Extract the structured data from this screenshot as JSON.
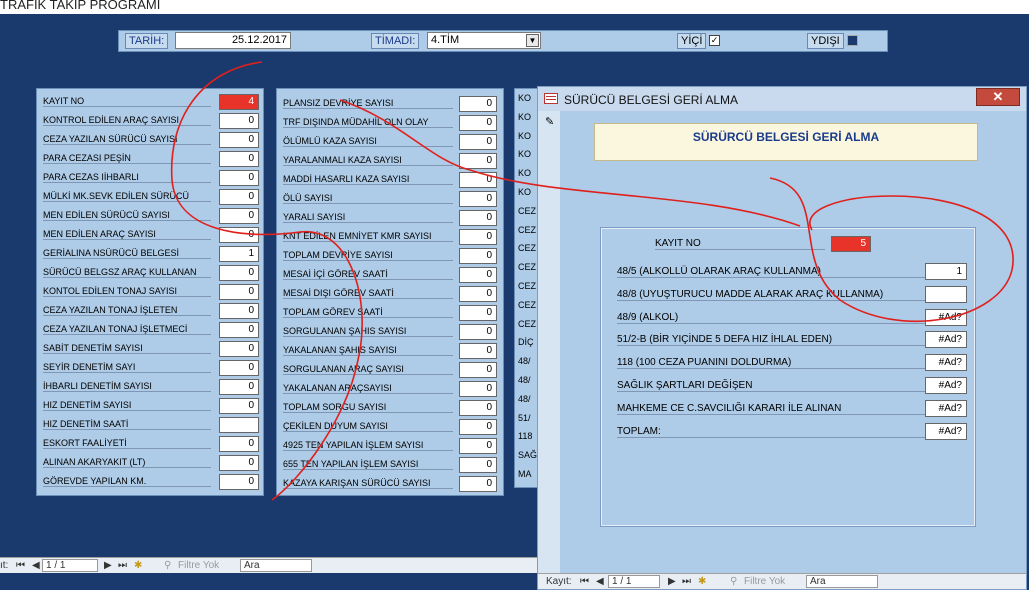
{
  "app": {
    "title": "TRAFİK TAKİP PROGRAMI"
  },
  "toolbar": {
    "date_label": "TARİH:",
    "date_value": "25.12.2017",
    "team_label": "TİMADI:",
    "team_value": "4.TİM",
    "inside_label": "YİÇİ",
    "inside_checked": "✓",
    "outside_label": "YDIŞI"
  },
  "left_panel": {
    "rows": [
      {
        "label": "KAYIT NO",
        "value": "4"
      },
      {
        "label": "KONTROL EDİLEN ARAÇ SAYISI",
        "value": "0"
      },
      {
        "label": "CEZA YAZILAN SÜRÜCÜ SAYISI",
        "value": "0"
      },
      {
        "label": "PARA CEZASI PEŞİN",
        "value": "0"
      },
      {
        "label": "PARA CEZAS IİHBARLI",
        "value": "0"
      },
      {
        "label": "MÜLKİ MK.SEVK EDİLEN SÜRÜCÜ",
        "value": "0"
      },
      {
        "label": "MEN EDİLEN SÜRÜCÜ SAYISI",
        "value": "0"
      },
      {
        "label": "MEN EDİLEN ARAÇ SAYISI",
        "value": "0"
      },
      {
        "label": "GERİALINA NSÜRÜCÜ BELGESİ",
        "value": "1"
      },
      {
        "label": "SÜRÜCÜ BELGSZ ARAÇ KULLANAN",
        "value": "0"
      },
      {
        "label": "KONTOL EDİLEN TONAJ SAYISI",
        "value": "0"
      },
      {
        "label": "CEZA YAZILAN TONAJ İŞLETEN",
        "value": "0"
      },
      {
        "label": "CEZA YAZILAN TONAJ İŞLETMECİ",
        "value": "0"
      },
      {
        "label": "SABİT DENETİM SAYISI",
        "value": "0"
      },
      {
        "label": "SEYİR DENETİM SAYI",
        "value": "0"
      },
      {
        "label": "İHBARLI DENETİM SAYISI",
        "value": "0"
      },
      {
        "label": "HIZ DENETİM SAYISI",
        "value": "0"
      },
      {
        "label": "HIZ DENETİM SAATİ",
        "value": ""
      },
      {
        "label": "ESKORT FAALİYETİ",
        "value": "0"
      },
      {
        "label": "ALINAN AKARYAKIT (LT)",
        "value": "0"
      },
      {
        "label": "GÖREVDE YAPILAN KM.",
        "value": "0"
      }
    ]
  },
  "mid_panel": {
    "rows": [
      {
        "label": "PLANSIZ DEVRİYE SAYISI",
        "value": "0"
      },
      {
        "label": "TRF DIŞINDA MÜDAHİL OLN OLAY",
        "value": "0"
      },
      {
        "label": "ÖLÜMLÜ KAZA SAYISI",
        "value": "0"
      },
      {
        "label": "YARALANMALI KAZA SAYISI",
        "value": "0"
      },
      {
        "label": "MADDİ HASARLI KAZA SAYISI",
        "value": "0"
      },
      {
        "label": "ÖLÜ SAYISI",
        "value": "0"
      },
      {
        "label": "YARALI SAYISI",
        "value": "0"
      },
      {
        "label": "KNT EDİLEN EMNİYET KMR SAYISI",
        "value": "0"
      },
      {
        "label": "TOPLAM DEVRİYE SAYISI",
        "value": "0"
      },
      {
        "label": "MESAİ İÇİ GÖREV SAATİ",
        "value": "0"
      },
      {
        "label": "MESAİ DIŞI GÖREV SAATİ",
        "value": "0"
      },
      {
        "label": "TOPLAM GÖREV SAATİ",
        "value": "0"
      },
      {
        "label": "SORGULANAN ŞAHIS SAYISI",
        "value": "0"
      },
      {
        "label": "YAKALANAN ŞAHIS SAYISI",
        "value": "0"
      },
      {
        "label": "SORGULANAN ARAÇ SAYISI",
        "value": "0"
      },
      {
        "label": "YAKALANAN ARAÇSAYISI",
        "value": "0"
      },
      {
        "label": "TOPLAM SORGU SAYISI",
        "value": "0"
      },
      {
        "label": "ÇEKİLEN DUYUM SAYISI",
        "value": "0"
      },
      {
        "label": "4925 TEN YAPILAN İŞLEM SAYISI",
        "value": "0"
      },
      {
        "label": "655 TEN YAPILAN İŞLEM SAYISI",
        "value": "0"
      },
      {
        "label": "KAZAYA KARIŞAN SÜRÜCÜ SAYISI",
        "value": "0"
      }
    ]
  },
  "peek_panel": {
    "items": [
      "KO",
      "KO",
      "KO",
      "KO",
      "KO",
      "KO",
      "CEZ",
      "CEZ",
      "CEZ",
      "CEZ",
      "CEZ",
      "CEZ",
      "CEZ",
      "DİÇ",
      "48/",
      "48/",
      "48/",
      "51/",
      "118",
      "SAĞ",
      "MA"
    ]
  },
  "main_nav": {
    "record_label": "ıt:",
    "position": "1 / 1",
    "filter_label": "Filtre Yok",
    "search_label": "Ara"
  },
  "dialog": {
    "title": "SÜRÜCÜ BELGESİ GERİ ALMA",
    "close_glyph": "✕",
    "heading": "SÜRÜRCÜ BELGESİ GERİ ALMA",
    "record_label": "KAYIT NO",
    "record_value": "5",
    "rows": [
      {
        "label": "48/5 (ALKOLLÜ OLARAK ARAÇ KULLANMA)",
        "value": "1"
      },
      {
        "label": "48/8 (UYUŞTURUCU MADDE ALARAK ARAÇ KULLANMA)",
        "value": ""
      },
      {
        "label": "48/9 (ALKOL)",
        "value": "#Ad?"
      },
      {
        "label": "51/2-B (BİR YIÇİNDE 5 DEFA HIZ İHLAL EDEN)",
        "value": "#Ad?"
      },
      {
        "label": "118 (100 CEZA PUANINI DOLDURMA)",
        "value": "#Ad?"
      },
      {
        "label": "SAĞLIK ŞARTLARI DEĞİŞEN",
        "value": "#Ad?"
      },
      {
        "label": "MAHKEME CE C.SAVCILIĞI KARARI İLE ALINAN",
        "value": "#Ad?"
      },
      {
        "label": "TOPLAM:",
        "value": "#Ad?"
      }
    ],
    "nav": {
      "record_label": "Kayıt:",
      "position": "1 / 1",
      "filter_label": "Filtre Yok",
      "search_label": "Ara"
    }
  },
  "colors": {
    "background": "#1a3a6e",
    "panel": "#aecbe7",
    "highlight_red": "#e8332a",
    "annotation": "#e0201b"
  }
}
